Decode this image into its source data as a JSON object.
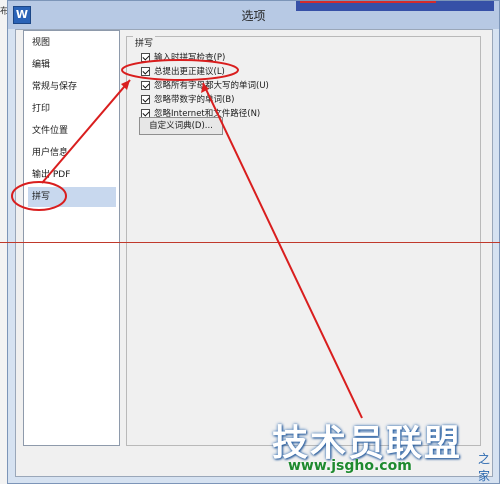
{
  "edge_label": "布",
  "window": {
    "title": "选项",
    "icon_label": "W"
  },
  "sidebar": {
    "items": [
      {
        "label": "视图"
      },
      {
        "label": "编辑"
      },
      {
        "label": "常规与保存"
      },
      {
        "label": "打印"
      },
      {
        "label": "文件位置"
      },
      {
        "label": "用户信息"
      },
      {
        "label": "输出 PDF"
      },
      {
        "label": "拼写",
        "selected": true
      }
    ]
  },
  "spelling": {
    "group_title": "拼写",
    "options": [
      {
        "label": "输入时拼写检查(P)",
        "checked": true
      },
      {
        "label": "总提出更正建议(L)",
        "checked": true
      },
      {
        "label": "忽略所有字母都大写的单词(U)",
        "checked": true
      },
      {
        "label": "忽略带数字的单词(B)",
        "checked": true
      },
      {
        "label": "忽略Internet和文件路径(N)",
        "checked": true
      }
    ],
    "dict_button": "自定义词典(D)..."
  },
  "watermark": {
    "main": "技术员联盟",
    "url": "www.jsgho.com",
    "side": "之家"
  },
  "colors": {
    "annotation": "#d91e1e",
    "selection": "#c8d8ee",
    "titlebar": "#b7c9e4"
  }
}
